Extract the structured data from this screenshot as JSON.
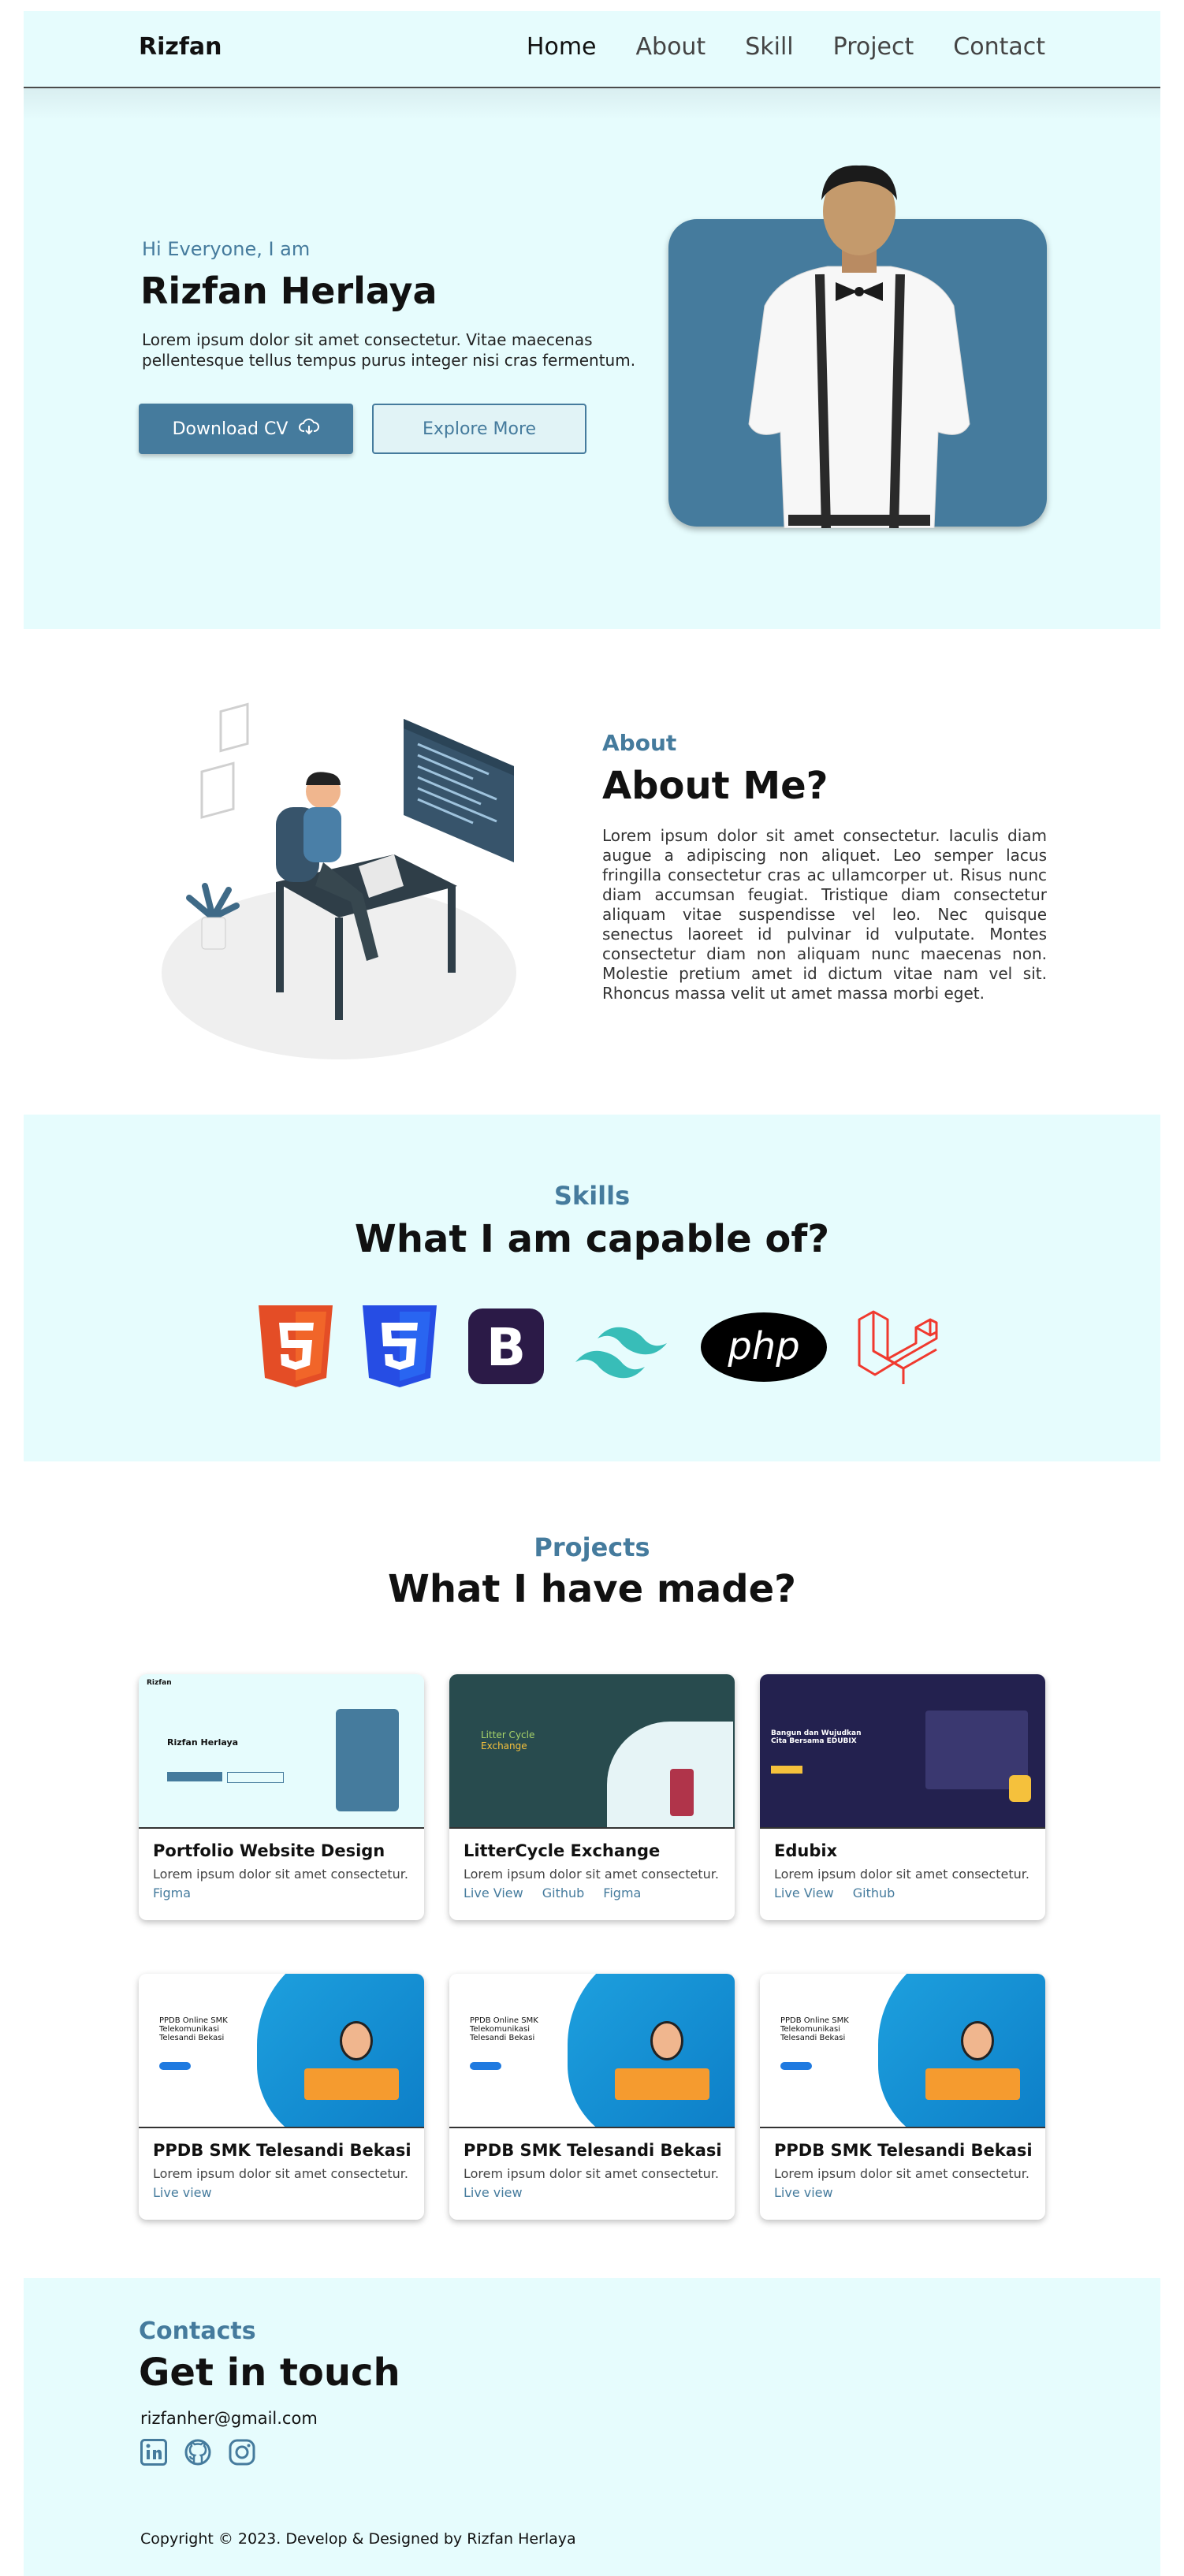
{
  "nav": {
    "brand": "Rizfan",
    "links": [
      "Home",
      "About",
      "Skill",
      "Project",
      "Contact"
    ]
  },
  "hero": {
    "greeting": "Hi Everyone, I am",
    "name": "Rizfan Herlaya",
    "description": "Lorem ipsum dolor sit amet consectetur. Vitae maecenas pellentesque tellus tempus purus integer nisi cras fermentum.",
    "download_label": "Download CV",
    "explore_label": "Explore More"
  },
  "about": {
    "tag": "About",
    "title": "About Me?",
    "text": "Lorem ipsum dolor sit amet consectetur. Iaculis diam augue a adipiscing non aliquet. Leo semper lacus fringilla consectetur cras ac ullamcorper ut. Risus nunc diam accumsan feugiat. Tristique diam consectetur aliquam vitae suspendisse vel leo. Nec quisque senectus laoreet id pulvinar id vulputate. Montes consectetur diam non aliquam nunc maecenas non. Molestie pretium amet id dictum vitae nam vel sit. Rhoncus massa velit ut amet massa morbi eget."
  },
  "skills": {
    "tag": "Skills",
    "title": "What I am capable of?",
    "icons": [
      "html5-icon",
      "css3-icon",
      "bootstrap-icon",
      "tailwind-icon",
      "php-icon",
      "laravel-icon"
    ],
    "php_text": "php",
    "bootstrap_text": "B"
  },
  "projects": {
    "tag": "Projects",
    "title": "What I have made?",
    "items": [
      {
        "title": "Portfolio Website Design",
        "desc": "Lorem ipsum dolor sit amet consectetur.",
        "links": [
          "Figma"
        ]
      },
      {
        "title": "LitterCycle Exchange",
        "desc": "Lorem ipsum dolor sit amet consectetur.",
        "links": [
          "Live View",
          "Github",
          "Figma"
        ]
      },
      {
        "title": "Edubix",
        "desc": "Lorem ipsum dolor sit amet consectetur.",
        "links": [
          "Live View",
          "Github"
        ]
      },
      {
        "title": "PPDB SMK Telesandi Bekasi",
        "desc": "Lorem ipsum dolor sit amet consectetur.",
        "links": [
          "Live view"
        ]
      },
      {
        "title": "PPDB SMK Telesandi Bekasi",
        "desc": "Lorem ipsum dolor sit amet consectetur.",
        "links": [
          "Live view"
        ]
      },
      {
        "title": "PPDB SMK Telesandi Bekasi",
        "desc": "Lorem ipsum dolor sit amet consectetur.",
        "links": [
          "Live view"
        ]
      }
    ],
    "thumb_text": {
      "portfolio_brand": "Rizfan",
      "portfolio_name": "Rizfan Herlaya",
      "litter_line1": "Litter Cycle",
      "litter_line2": "Exchange",
      "edubix_heading": "Bangun dan Wujudkan Cita Bersama EDUBIX",
      "ppdb_heading": "PPDB Online SMK Telekomunikasi Telesandi Bekasi"
    }
  },
  "contacts": {
    "tag": "Contacts",
    "title": "Get in touch",
    "email": "rizfanher@gmail.com",
    "icons": [
      "linkedin-icon",
      "github-icon",
      "instagram-icon"
    ],
    "copyright": "Copyright © 2023. Develop & Designed by Rizfan Herlaya"
  },
  "colors": {
    "accent": "#457b9d",
    "light_bg": "#e6fcfd"
  }
}
